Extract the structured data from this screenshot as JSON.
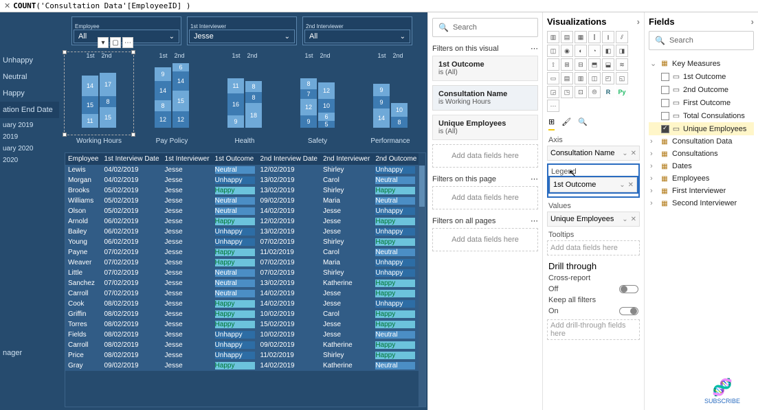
{
  "formula": {
    "func": "COUNT",
    "code": "'Consultation Data'[EmployeeID] )"
  },
  "slicers": [
    {
      "label": "Employee",
      "value": "All"
    },
    {
      "label": "1st Interviewer",
      "value": "Jesse"
    },
    {
      "label": "2nd Interviewer",
      "value": "All"
    }
  ],
  "left_nav": {
    "moods": [
      "Unhappy",
      "Neutral",
      "Happy"
    ],
    "date_header": "ation End Date",
    "dates": [
      "uary 2019",
      "2019",
      "uary 2020",
      "2020"
    ],
    "footer": "nager"
  },
  "col_heads": {
    "first": "1st",
    "second": "2nd"
  },
  "charts": [
    {
      "title": "Working Hours",
      "selected": true,
      "cols": [
        [
          [
            "14",
            30
          ],
          [
            "15",
            26
          ],
          [
            "11",
            20
          ]
        ],
        [
          [
            "17",
            34
          ],
          [
            "8",
            16
          ],
          [
            "15",
            30
          ]
        ]
      ]
    },
    {
      "title": "Pay Policy",
      "cols": [
        [
          [
            "9",
            20
          ],
          [
            "14",
            28
          ],
          [
            "8",
            16
          ],
          [
            "12",
            24
          ]
        ],
        [
          [
            "6",
            12
          ],
          [
            "14",
            28
          ],
          [
            "15",
            30
          ],
          [
            "12",
            24
          ]
        ]
      ]
    },
    {
      "title": "Health",
      "cols": [
        [
          [
            "11",
            22
          ],
          [
            "16",
            32
          ],
          [
            "9",
            18
          ]
        ],
        [
          [
            "8",
            16
          ],
          [
            "8",
            16
          ],
          [
            "18",
            36
          ]
        ]
      ]
    },
    {
      "title": "Safety",
      "cols": [
        [
          [
            "8",
            16
          ],
          [
            "7",
            14
          ],
          [
            "12",
            24
          ],
          [
            "9",
            18
          ]
        ],
        [
          [
            "12",
            24
          ],
          [
            "10",
            20
          ],
          [
            "6",
            12
          ],
          [
            "5",
            10
          ]
        ]
      ]
    },
    {
      "title": "Performance",
      "cols": [
        [
          [
            "9",
            18
          ],
          [
            "9",
            18
          ],
          [
            "14",
            28
          ]
        ],
        [
          [
            "10",
            20
          ],
          [
            "8",
            16
          ]
        ]
      ]
    }
  ],
  "table": {
    "headers": [
      "Employee",
      "1st Interview Date",
      "1st Interviewer",
      "1st Outcome",
      "2nd Interview Date",
      "2nd Interviewer",
      "2nd Outcome"
    ],
    "rows": [
      [
        "Lewis",
        "04/02/2019",
        "Jesse",
        "Neutral",
        "12/02/2019",
        "Shirley",
        "Unhappy"
      ],
      [
        "Morgan",
        "04/02/2019",
        "Jesse",
        "Unhappy",
        "13/02/2019",
        "Carol",
        "Neutral"
      ],
      [
        "Brooks",
        "05/02/2019",
        "Jesse",
        "Happy",
        "13/02/2019",
        "Shirley",
        "Happy"
      ],
      [
        "Williams",
        "05/02/2019",
        "Jesse",
        "Neutral",
        "09/02/2019",
        "Maria",
        "Neutral"
      ],
      [
        "Olson",
        "05/02/2019",
        "Jesse",
        "Neutral",
        "14/02/2019",
        "Jesse",
        "Unhappy"
      ],
      [
        "Arnold",
        "06/02/2019",
        "Jesse",
        "Happy",
        "12/02/2019",
        "Jesse",
        "Happy"
      ],
      [
        "Bailey",
        "06/02/2019",
        "Jesse",
        "Unhappy",
        "13/02/2019",
        "Jesse",
        "Unhappy"
      ],
      [
        "Young",
        "06/02/2019",
        "Jesse",
        "Unhappy",
        "07/02/2019",
        "Shirley",
        "Happy"
      ],
      [
        "Payne",
        "07/02/2019",
        "Jesse",
        "Happy",
        "11/02/2019",
        "Carol",
        "Neutral"
      ],
      [
        "Weaver",
        "07/02/2019",
        "Jesse",
        "Happy",
        "07/02/2019",
        "Maria",
        "Unhappy"
      ],
      [
        "Little",
        "07/02/2019",
        "Jesse",
        "Neutral",
        "07/02/2019",
        "Shirley",
        "Unhappy"
      ],
      [
        "Sanchez",
        "07/02/2019",
        "Jesse",
        "Neutral",
        "13/02/2019",
        "Katherine",
        "Happy"
      ],
      [
        "Carroll",
        "07/02/2019",
        "Jesse",
        "Neutral",
        "14/02/2019",
        "Jesse",
        "Happy"
      ],
      [
        "Cook",
        "08/02/2019",
        "Jesse",
        "Happy",
        "14/02/2019",
        "Jesse",
        "Unhappy"
      ],
      [
        "Griffin",
        "08/02/2019",
        "Jesse",
        "Happy",
        "10/02/2019",
        "Carol",
        "Happy"
      ],
      [
        "Torres",
        "08/02/2019",
        "Jesse",
        "Happy",
        "15/02/2019",
        "Jesse",
        "Happy"
      ],
      [
        "Fields",
        "08/02/2019",
        "Jesse",
        "Unhappy",
        "10/02/2019",
        "Jesse",
        "Neutral"
      ],
      [
        "Carroll",
        "08/02/2019",
        "Jesse",
        "Unhappy",
        "09/02/2019",
        "Katherine",
        "Happy"
      ],
      [
        "Price",
        "08/02/2019",
        "Jesse",
        "Unhappy",
        "11/02/2019",
        "Shirley",
        "Happy"
      ],
      [
        "Gray",
        "09/02/2019",
        "Jesse",
        "Happy",
        "14/02/2019",
        "Katherine",
        "Neutral"
      ]
    ]
  },
  "filters": {
    "search_ph": "Search",
    "visual_h": "Filters on this visual",
    "page_h": "Filters on this page",
    "all_h": "Filters on all pages",
    "add_txt": "Add data fields here",
    "cards": [
      {
        "title": "1st Outcome",
        "val": "is (All)"
      },
      {
        "title": "Consultation Name",
        "val": "is Working Hours",
        "sel": true
      },
      {
        "title": "Unique Employees",
        "val": "is (All)"
      }
    ]
  },
  "viz": {
    "title": "Visualizations",
    "tabs": {
      "fields": "⊞",
      "format": "🖌",
      "analytics": "🔍"
    },
    "wells": {
      "axis_l": "Axis",
      "axis_v": "Consultation Name",
      "legend_l": "Legend",
      "legend_v": "1st Outcome",
      "values_l": "Values",
      "values_v": "Unique Employees",
      "tooltips_l": "Tooltips",
      "tooltips_v": "Add data fields here"
    },
    "drill": {
      "h": "Drill through",
      "cross_l": "Cross-report",
      "cross_state": "Off",
      "keep_l": "Keep all filters",
      "keep_state": "On",
      "add": "Add drill-through fields here"
    }
  },
  "fields": {
    "title": "Fields",
    "search_ph": "Search",
    "tables": [
      {
        "name": "Key Measures",
        "open": true,
        "fields": [
          {
            "name": "1st Outcome",
            "checked": false,
            "ico": "▭"
          },
          {
            "name": "2nd Outcome",
            "checked": false,
            "ico": "▭"
          },
          {
            "name": "First Outcome",
            "checked": false,
            "ico": "▭"
          },
          {
            "name": "Total Consulations",
            "checked": false,
            "ico": "▭"
          },
          {
            "name": "Unique Employees",
            "checked": true,
            "ico": "▭",
            "sel": true
          }
        ]
      },
      {
        "name": "Consultation Data",
        "open": false
      },
      {
        "name": "Consultations",
        "open": false
      },
      {
        "name": "Dates",
        "open": false
      },
      {
        "name": "Employees",
        "open": false
      },
      {
        "name": "First Interviewer",
        "open": false
      },
      {
        "name": "Second Interviewer",
        "open": false
      }
    ]
  },
  "subscribe": "SUBSCRIBE"
}
